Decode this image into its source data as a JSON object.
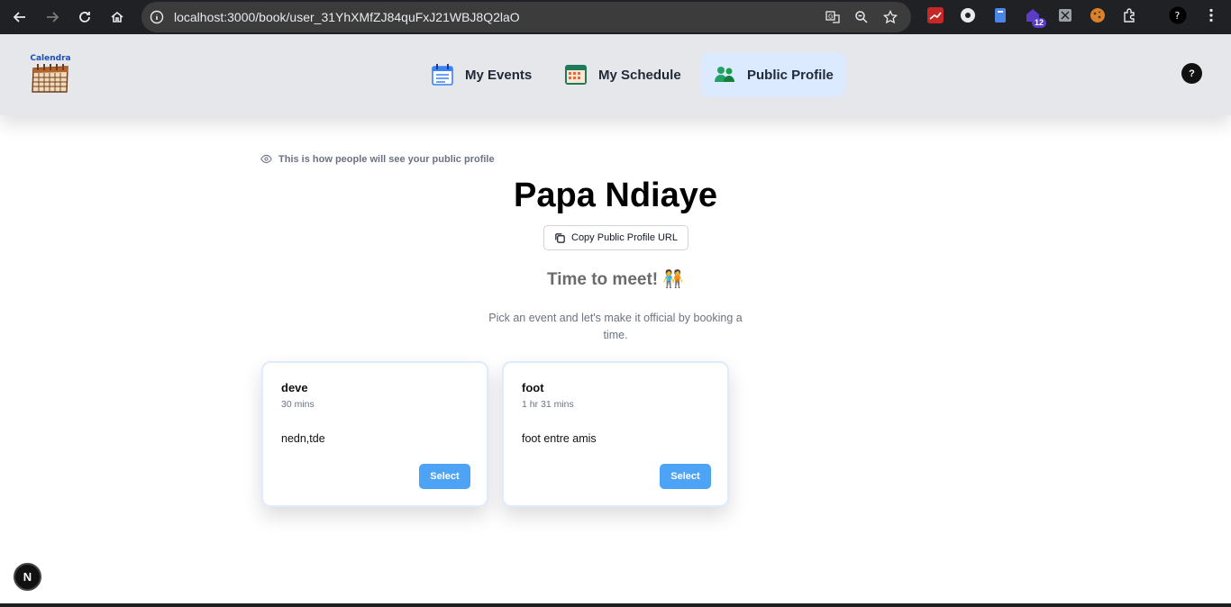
{
  "browser": {
    "url": "localhost:3000/book/user_31YhXMfZJ84quFxJ21WBJ8Q2laO",
    "extension_badge": "12"
  },
  "header": {
    "logo_text": "Calendra",
    "nav": [
      {
        "label": "My Events",
        "icon": "calendar-list-icon",
        "active": false
      },
      {
        "label": "My Schedule",
        "icon": "calendar-grid-icon",
        "active": false
      },
      {
        "label": "Public Profile",
        "icon": "people-icon",
        "active": true
      }
    ],
    "avatar_text": "?"
  },
  "main": {
    "notice": "This is how people will see your public profile",
    "profile_name": "Papa Ndiaye",
    "copy_button": "Copy Public Profile URL",
    "meet_title": "Time to meet! 🧑‍🤝‍🧑",
    "meet_subtitle": "Pick an event and let's make it official by booking a time.",
    "events": [
      {
        "title": "deve",
        "duration": "30 mins",
        "description": "nedn,tde",
        "button": "Select"
      },
      {
        "title": "foot",
        "duration": "1 hr 31 mins",
        "description": "foot entre amis",
        "button": "Select"
      }
    ]
  },
  "dev_badge": "N",
  "colors": {
    "accent": "#4da3f5",
    "active_nav_bg": "#dbeafe",
    "header_bg": "#e5e7eb"
  }
}
